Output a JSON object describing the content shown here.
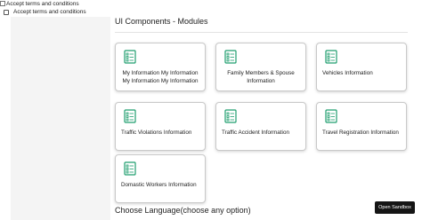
{
  "terms": {
    "top_label": "Accept terms and conditions",
    "second_label": "Accept terms and conditions"
  },
  "main": {
    "title": "UI Components - Modules",
    "cards": [
      {
        "label": "My Information My Information My Information My Information",
        "icon": "form-document-icon"
      },
      {
        "label": "Family Members & Spouse Information",
        "icon": "form-document-icon"
      },
      {
        "label": "Vehicles Information",
        "icon": "form-document-icon"
      },
      {
        "label": "Traffic Violations Information",
        "icon": "form-document-icon"
      },
      {
        "label": "Traffic Accident Information",
        "icon": "form-document-icon"
      },
      {
        "label": "Travel Registration Information",
        "icon": "form-document-icon"
      },
      {
        "label": "Domastic Workers Information",
        "icon": "form-document-icon"
      }
    ],
    "language_title": "Choose Language(choose any option)"
  },
  "sandbox": {
    "label": "Open Sandbox"
  },
  "colors": {
    "icon_accent": "#1e9e6e",
    "button_bg": "#151515"
  }
}
